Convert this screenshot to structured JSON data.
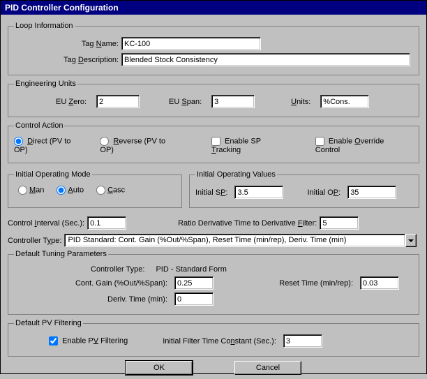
{
  "title": "PID Controller Configuration",
  "loopInfo": {
    "legend": "Loop Information",
    "tagNameLabel_pre": "Tag ",
    "tagNameLabel_u": "N",
    "tagNameLabel_post": "ame:",
    "tagName": "KC-100",
    "tagDescLabel_pre": "Tag ",
    "tagDescLabel_u": "D",
    "tagDescLabel_post": "escription:",
    "tagDesc": "Blended Stock Consistency"
  },
  "engUnits": {
    "legend": "Engineering Units",
    "zeroLabel_pre": "EU ",
    "zeroLabel_u": "Z",
    "zeroLabel_post": "ero:",
    "zero": "2",
    "spanLabel_pre": "EU ",
    "spanLabel_u": "S",
    "spanLabel_post": "pan:",
    "span": "3",
    "unitsLabel_u": "U",
    "unitsLabel_post": "nits:",
    "units": "%Cons."
  },
  "controlAction": {
    "legend": "Control Action",
    "direct_u": "D",
    "direct_post": "irect (PV to OP)",
    "reverse_u": "R",
    "reverse_post": "everse (PV to OP)",
    "spTrack_pre": "Enable SP ",
    "spTrack_u": "T",
    "spTrack_post": "racking",
    "override_pre": "Enable ",
    "override_u": "O",
    "override_post": "verride Control"
  },
  "initMode": {
    "legend": "Initial Operating Mode",
    "man_u": "M",
    "man_post": "an",
    "auto_u": "A",
    "auto_post": "uto",
    "casc_u": "C",
    "casc_post": "asc"
  },
  "initVals": {
    "legend": "Initial Operating Values",
    "sp_pre": "Initial S",
    "sp_u": "P",
    "sp_post": ":",
    "sp": "3.5",
    "op_pre": "Initial O",
    "op_u": "P",
    "op_post": ":",
    "op": "35"
  },
  "interval": {
    "label_pre": "Control ",
    "label_u": "I",
    "label_post": "nterval (Sec.):",
    "value": "0.1",
    "ratio_pre": "Ratio Derivative Time to Derivative ",
    "ratio_u": "F",
    "ratio_post": "ilter:",
    "ratio": "5"
  },
  "ctype": {
    "label_pre": "Controller T",
    "label_u": "y",
    "label_post": "pe:",
    "value": "PID Standard: Cont. Gain (%Out/%Span), Reset Time (min/rep), Deriv. Time (min)"
  },
  "tuning": {
    "legend": "Default Tuning Parameters",
    "ctypeLabel": "Controller Type:",
    "ctypeValue": "PID - Standard Form",
    "gainLabel": "Cont. Gain (%Out/%Span):",
    "gain": "0.25",
    "resetLabel": "Reset Time (min/rep):",
    "reset": "0.03",
    "derivLabel": "Deriv. Time (min):",
    "deriv": "0"
  },
  "pvfilter": {
    "legend": "Default PV Filtering",
    "enable_pre": "Enable P",
    "enable_u": "V",
    "enable_post": " Filtering",
    "tc_pre": "Initial Filter Time Co",
    "tc_u": "n",
    "tc_post": "stant (Sec.):",
    "tc": "3"
  },
  "buttons": {
    "ok": "OK",
    "cancel": "Cancel"
  }
}
